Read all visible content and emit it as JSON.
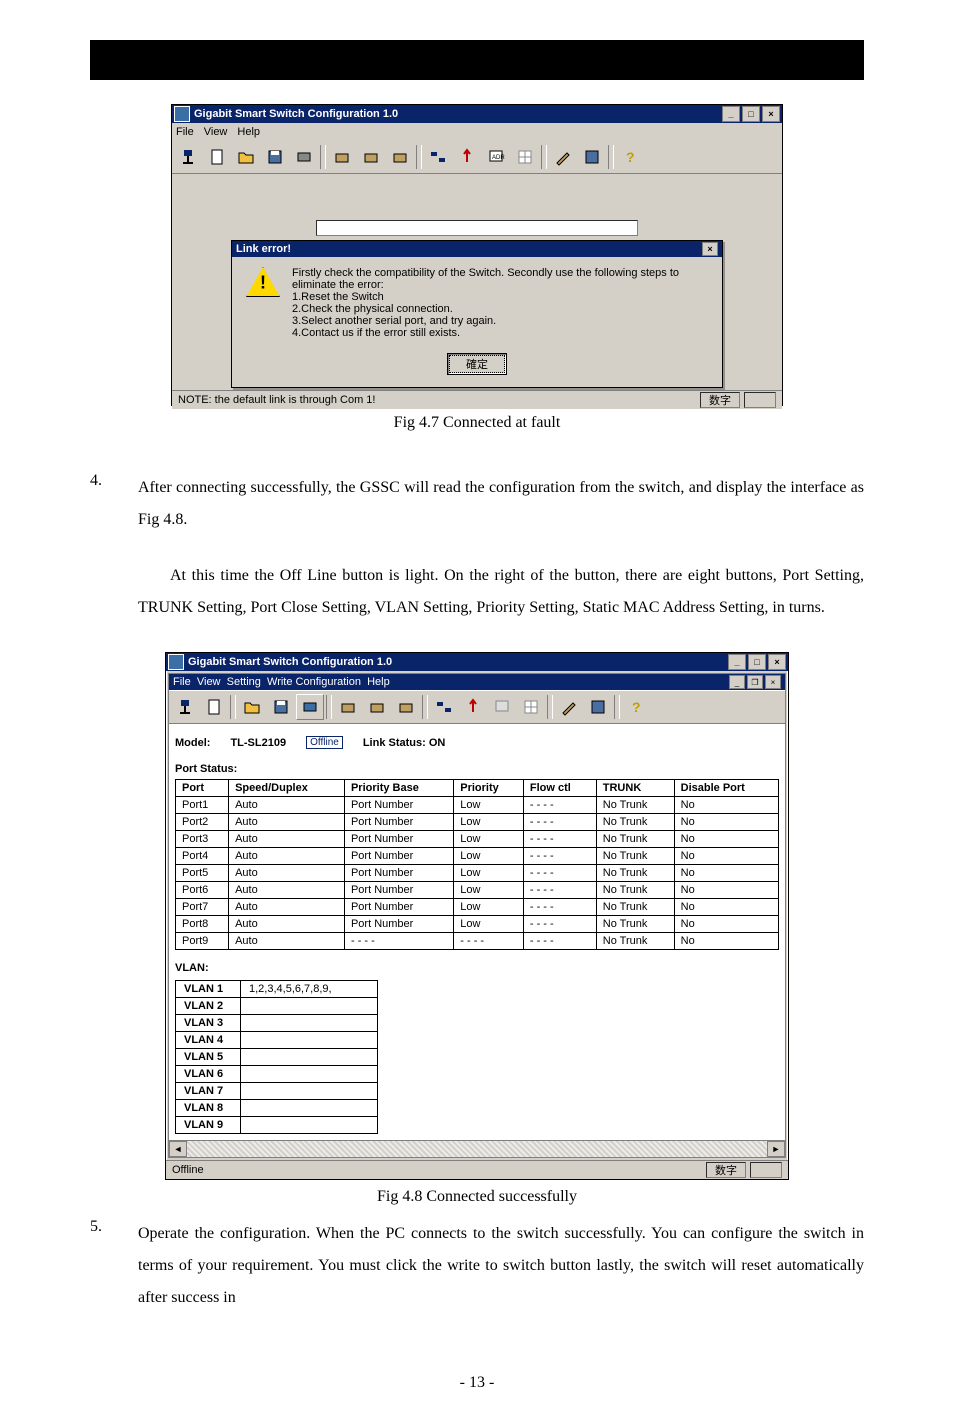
{
  "app_title": "Gigabit Smart Switch Configuration 1.0",
  "menus": {
    "file": "File",
    "view": "View",
    "setting": "Setting",
    "writecfg": "Write Configuration",
    "help": "Help"
  },
  "win1": {
    "status_note": "NOTE: the default link is through Com 1!",
    "status_mode": "数字",
    "dialog_title": "Link error!",
    "dialog_msg": "Firstly check the compatibility of the Switch. Secondly use the following steps to eliminate the error:",
    "dialog_steps": [
      "1.Reset the Switch",
      "2.Check the physical connection.",
      "3.Select another serial port, and try again.",
      "4.Contact us if the error still exists."
    ],
    "ok": "確定"
  },
  "fig1_caption": "Fig 4.7 Connected at fault",
  "paragraph_4": "After connecting successfully, the GSSC will read the configuration from the switch, and display the interface as Fig 4.8.",
  "paragraph_4b": "At this time the Off Line button is light. On the right of the button, there are eight buttons, Port Setting, TRUNK Setting, Port Close Setting, VLAN Setting, Priority Setting, Static MAC Address Setting, in turns.",
  "win2": {
    "model_label": "Model:",
    "model": "TL-SL2109",
    "badge": "Offline",
    "linkstatus_label": "Link Status:",
    "linkstatus": "ON",
    "portstatus_label": "Port Status:",
    "headers": [
      "Port",
      "Speed/Duplex",
      "Priority Base",
      "Priority",
      "Flow ctl",
      "TRUNK",
      "Disable Port"
    ],
    "rows": [
      [
        "Port1",
        "Auto",
        "Port Number",
        "Low",
        "- - - -",
        "No Trunk",
        "No"
      ],
      [
        "Port2",
        "Auto",
        "Port Number",
        "Low",
        "- - - -",
        "No Trunk",
        "No"
      ],
      [
        "Port3",
        "Auto",
        "Port Number",
        "Low",
        "- - - -",
        "No Trunk",
        "No"
      ],
      [
        "Port4",
        "Auto",
        "Port Number",
        "Low",
        "- - - -",
        "No Trunk",
        "No"
      ],
      [
        "Port5",
        "Auto",
        "Port Number",
        "Low",
        "- - - -",
        "No Trunk",
        "No"
      ],
      [
        "Port6",
        "Auto",
        "Port Number",
        "Low",
        "- - - -",
        "No Trunk",
        "No"
      ],
      [
        "Port7",
        "Auto",
        "Port Number",
        "Low",
        "- - - -",
        "No Trunk",
        "No"
      ],
      [
        "Port8",
        "Auto",
        "Port Number",
        "Low",
        "- - - -",
        "No Trunk",
        "No"
      ],
      [
        "Port9",
        "Auto",
        "- - - -",
        "- - - -",
        "- - - -",
        "No Trunk",
        "No"
      ]
    ],
    "vlan_label": "VLAN:",
    "vlan_rows": [
      [
        "VLAN 1",
        "1,2,3,4,5,6,7,8,9,"
      ],
      [
        "VLAN 2",
        ""
      ],
      [
        "VLAN 3",
        ""
      ],
      [
        "VLAN 4",
        ""
      ],
      [
        "VLAN 5",
        ""
      ],
      [
        "VLAN 6",
        ""
      ],
      [
        "VLAN 7",
        ""
      ],
      [
        "VLAN 8",
        ""
      ],
      [
        "VLAN 9",
        ""
      ]
    ],
    "status_left": "Offline",
    "status_right": "数字"
  },
  "fig2_caption": "Fig 4.8 Connected successfully",
  "paragraph_5": "Operate the configuration. When the PC connects to the switch successfully. You can configure the switch in terms of your requirement. You must click the write to switch button lastly, the switch will reset automatically after success in",
  "page_number": "- 13 -",
  "list4": "4.",
  "list5": "5."
}
